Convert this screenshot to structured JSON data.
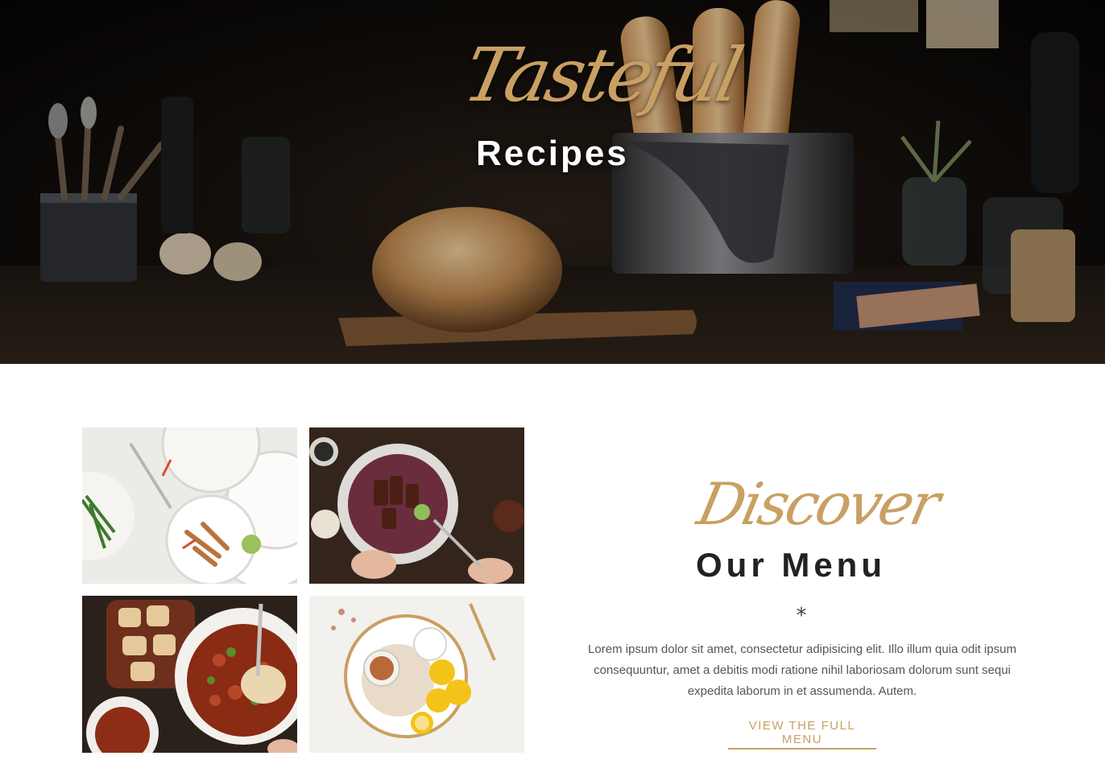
{
  "hero": {
    "script_title": "Tasteful",
    "title": "Recipes"
  },
  "gallery": {
    "items": [
      {
        "name": "salad-plates-photo"
      },
      {
        "name": "beef-bowl-photo"
      },
      {
        "name": "stew-dumplings-photo"
      },
      {
        "name": "lemon-dessert-photo"
      }
    ]
  },
  "menu_section": {
    "script_title": "Discover",
    "title": "Our Menu",
    "divider": "*",
    "description": "Lorem ipsum dolor sit amet, consectetur adipisicing elit. Illo illum quia odit ipsum consequuntur, amet a debitis modi ratione nihil laboriosam dolorum sunt sequi expedita laborum in et assumenda. Autem.",
    "cta_label": "VIEW THE FULL MENU"
  },
  "colors": {
    "accent": "#c9a063",
    "heading_dark": "#222222",
    "body_text": "#555555",
    "hero_bg": "#120e0b"
  }
}
